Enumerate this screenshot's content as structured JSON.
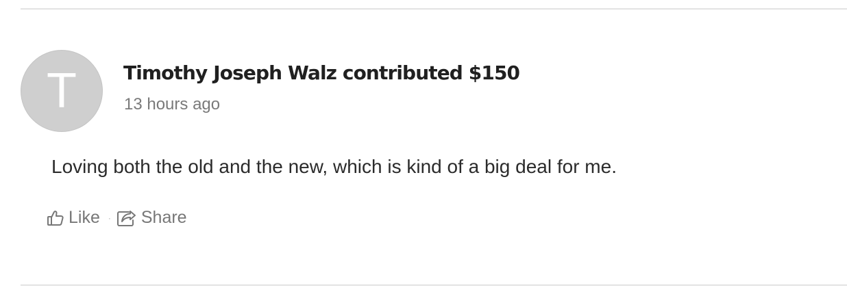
{
  "post": {
    "avatar_initial": "T",
    "contributor_headline": "Timothy Joseph Walz contributed $150",
    "timestamp": "13 hours ago",
    "message": "Loving both the old and the new, which is kind of a big deal for me."
  },
  "actions": {
    "like_label": "Like",
    "like_icon": "thumbs-up-icon",
    "separator": "·",
    "share_label": "Share",
    "share_icon": "share-icon"
  },
  "colors": {
    "avatar_bg": "#cfcfcf",
    "divider": "#e3e3e3",
    "muted_text": "#777777"
  }
}
